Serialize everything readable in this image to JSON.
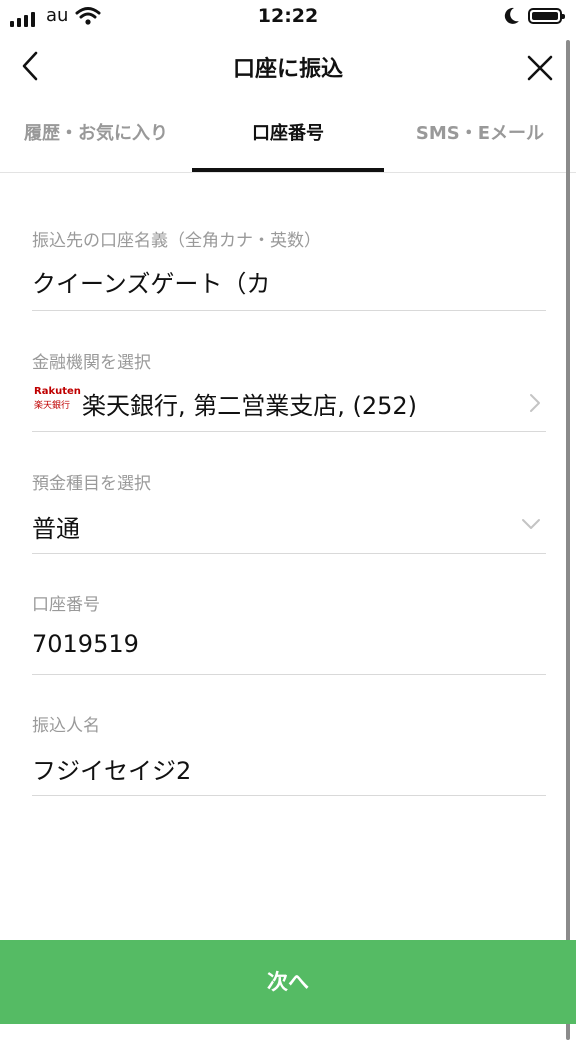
{
  "status_bar": {
    "carrier": "au",
    "time": "12:22"
  },
  "nav": {
    "title": "口座に振込"
  },
  "tabs": [
    {
      "label": "履歴・お気に入り",
      "active": false
    },
    {
      "label": "口座番号",
      "active": true
    },
    {
      "label": "SMS・Eメール",
      "active": false
    }
  ],
  "form": {
    "account_name": {
      "label": "振込先の口座名義（全角カナ・英数）",
      "value": "クイーンズゲート（カ"
    },
    "bank": {
      "label": "金融機関を選択",
      "value": "楽天銀行, 第二営業支店, (252)",
      "logo_line1": "Rakuten",
      "logo_line2": "楽天銀行"
    },
    "deposit_type": {
      "label": "預金種目を選択",
      "value": "普通"
    },
    "account_number": {
      "label": "口座番号",
      "value": "7019519"
    },
    "sender_name": {
      "label": "振込人名",
      "value": "フジイセイジ2"
    }
  },
  "footer": {
    "next_label": "次へ"
  },
  "colors": {
    "accent": "#55bb64",
    "bank_red": "#bf0000"
  }
}
